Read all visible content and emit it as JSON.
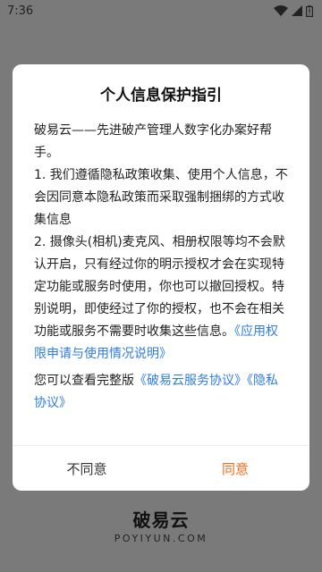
{
  "status_bar": {
    "time": "7:36"
  },
  "brand": {
    "name": "破易云",
    "domain": "POYIYUN.COM"
  },
  "dialog": {
    "title": "个人信息保护指引",
    "intro": "破易云——先进破产管理人数字化办案好帮手。",
    "item1": "1. 我们遵循隐私政策收集、使用个人信息，不会因同意本隐私政策而采取强制捆绑的方式收集信息",
    "item2": "2. 摄像头(相机)麦克风、相册权限等均不会默认开启，只有经过你的明示授权才会在实现特定功能或服务时使用，你也可以撤回授权。特别说明，即使经过了你的授权，也不会在相关功能或服务不需要时收集这些信息。",
    "permissions_link": "《应用权限申请与使用情况说明》",
    "view_prefix": "您可以查看完整版",
    "service_link": "《破易云服务协议》",
    "privacy_link": "《隐私协议》",
    "disagree_label": "不同意",
    "agree_label": "同意"
  },
  "colors": {
    "link": "#2f7de1",
    "agree": "#f26a1b",
    "overlay": "#7a7a7a"
  },
  "icons": [
    "wifi-icon",
    "signal-icon",
    "battery-icon"
  ]
}
